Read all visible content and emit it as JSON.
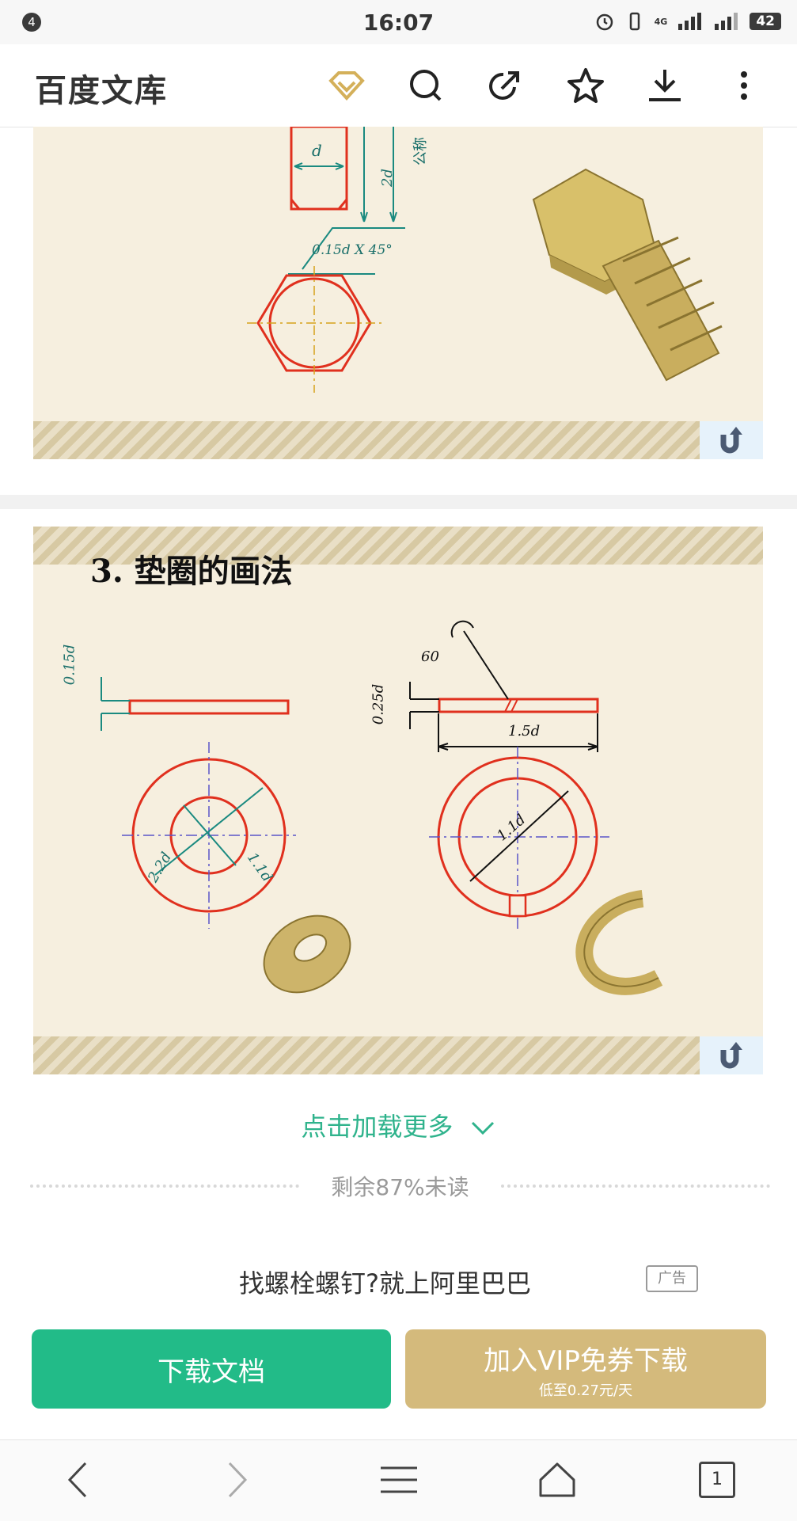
{
  "status": {
    "notification_count": "4",
    "time": "16:07",
    "network": "4G",
    "battery": "42"
  },
  "header": {
    "title": "百度文库",
    "icons": [
      "vip-diamond-icon",
      "search-icon",
      "share-icon",
      "star-icon",
      "download-icon",
      "more-icon"
    ]
  },
  "slide1": {
    "labels": {
      "d": "d",
      "height": "2d",
      "nominal": "公称",
      "chamfer": "0.15d X 45°"
    }
  },
  "slide2": {
    "title": "3.  垫圈的画法",
    "labels": {
      "t1": "0.15d",
      "t2": "0.25d",
      "angle": "60",
      "len": "1.5d",
      "outer": "2.2d",
      "inner": "1.1d",
      "inner2": "1.1d"
    }
  },
  "load_more": {
    "label": "点击加载更多"
  },
  "remaining": {
    "label": "剩余87%未读"
  },
  "ad": {
    "text": "找螺栓螺钉?就上阿里巴巴",
    "badge": "广告"
  },
  "actions": {
    "download": "下载文档",
    "vip_main": "加入VIP免券下载",
    "vip_sub": "低至0.27元/天"
  },
  "nav": {
    "tab_count": "1"
  },
  "colors": {
    "accent_green": "#22bb88",
    "link_green": "#2fb38c",
    "vip_gold": "#d4ba7c",
    "drawing_red": "#e0301e"
  }
}
